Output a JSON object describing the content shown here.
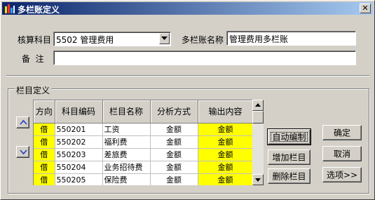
{
  "window": {
    "title": "多栏账定义",
    "close_glyph": "✕"
  },
  "form": {
    "account_label": "核算科目",
    "account_value": "5502 管理费用",
    "ledger_name_label": "多栏账名称",
    "ledger_name_value": "管理费用多栏账",
    "remark_label": "备  注",
    "remark_value": ""
  },
  "group": {
    "label": "栏目定义"
  },
  "table": {
    "headers": [
      "方向",
      "科目编码",
      "栏目名称",
      "分析方式",
      "输出内容"
    ],
    "rows": [
      [
        "借",
        "550201",
        "工资",
        "金额",
        "金额"
      ],
      [
        "借",
        "550202",
        "福利费",
        "金额",
        "金额"
      ],
      [
        "借",
        "550203",
        "差旅费",
        "金额",
        "金额"
      ],
      [
        "借",
        "550204",
        "业务招待费",
        "金额",
        "金额"
      ],
      [
        "借",
        "550205",
        "保险费",
        "金额",
        "金额"
      ]
    ]
  },
  "side_buttons": {
    "auto": "自动编制",
    "add": "增加栏目",
    "delete": "删除栏目"
  },
  "right_buttons": {
    "ok": "确定",
    "cancel": "取消",
    "options": "选项>>"
  },
  "icons": {
    "move_up": "triangle-up-icon",
    "move_down": "triangle-down-icon",
    "dropdown": "chevron-down-icon"
  },
  "colors": {
    "title_start": "#0a246a",
    "title_end": "#a6caf0",
    "highlight": "#ffff00"
  }
}
